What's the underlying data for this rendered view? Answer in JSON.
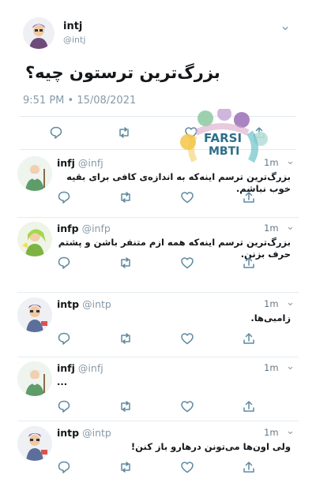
{
  "tweet": {
    "name": "intj",
    "handle": "@intj",
    "text": "بزرگ‌ترین ترستون چیه؟",
    "timestamp": "9:51 PM • 15/08/2021"
  },
  "watermark": {
    "line1": "FARSI",
    "line2": "MBTI"
  },
  "replies": [
    {
      "name": "infj",
      "handle": "@infj",
      "time": "1m",
      "text": "بزرگ‌ترین ترسم اینه‌که به اندازه‌ی کافی برای بقیه خوب نباشم."
    },
    {
      "name": "infp",
      "handle": "@infp",
      "time": "1m",
      "text": "بزرگ‌ترین ترسم اینه‌که همه ازم متنفر باشن و پشتم حرف بزنن."
    },
    {
      "name": "intp",
      "handle": "@intp",
      "time": "1m",
      "text": "زامبی‌ها."
    },
    {
      "name": "infj",
      "handle": "@infj",
      "time": "1m",
      "text": "..."
    },
    {
      "name": "intp",
      "handle": "@intp",
      "time": "1m",
      "text": "ولی اون‌ها می‌تونن درهارو باز کنن!"
    }
  ],
  "icons": {
    "reply": "reply-icon",
    "retweet": "retweet-icon",
    "like": "like-icon",
    "share": "share-icon",
    "more": "chevron-down-icon"
  },
  "colors": {
    "icon": "#5e8aa0",
    "muted": "#8899a6",
    "divider": "#e1e8ed",
    "watermark_text": "#2c6f8a"
  }
}
